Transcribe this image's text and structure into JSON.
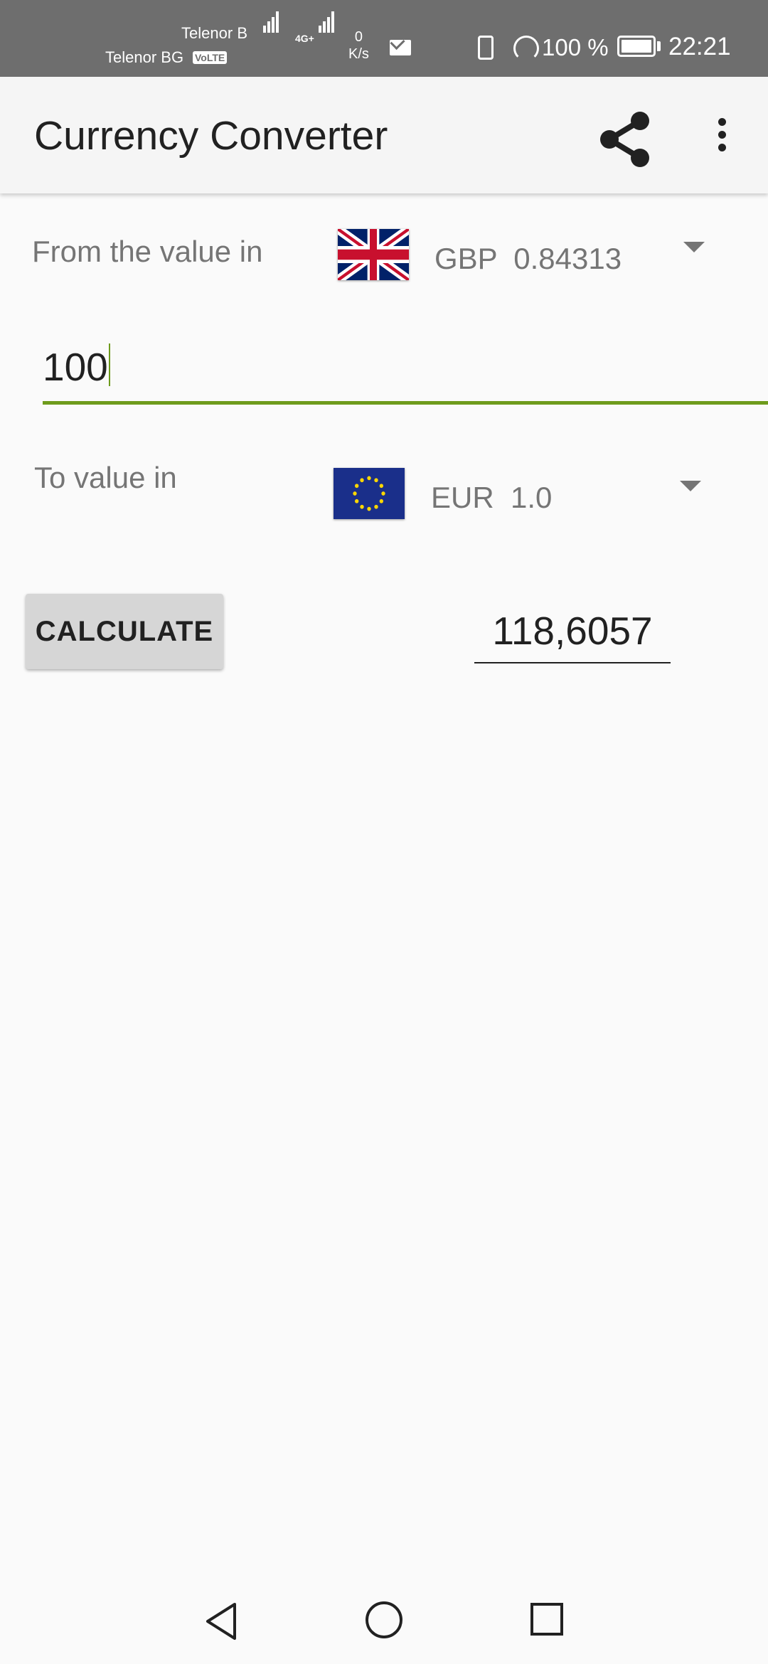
{
  "status_bar": {
    "carrier_1": "Telenor B",
    "carrier_2": "Telenor BG",
    "volte": "VoLTE",
    "network": "4G+",
    "speed_value": "0",
    "speed_unit": "K/s",
    "battery": "100 %",
    "time": "22:21"
  },
  "app_bar": {
    "title": "Currency Converter",
    "share_icon": "share-icon",
    "menu_icon": "more-vert-icon"
  },
  "from": {
    "label": "From the value in",
    "flag": "uk-flag",
    "currency": "GBP  0.84313"
  },
  "amount": {
    "value": "100"
  },
  "to": {
    "label": "To value in",
    "flag": "eu-flag",
    "currency": "EUR  1.0"
  },
  "calculate": {
    "label": "CALCULATE"
  },
  "result": {
    "value": "118,6057"
  },
  "navigation": {
    "back_icon": "back-icon",
    "home_icon": "home-icon",
    "recents_icon": "recents-icon"
  },
  "colors": {
    "accent": "#6e9b1c",
    "status_bar": "#6e6e6e",
    "app_bar": "#f5f5f5",
    "background": "#fafafa",
    "button": "#d6d6d6"
  }
}
